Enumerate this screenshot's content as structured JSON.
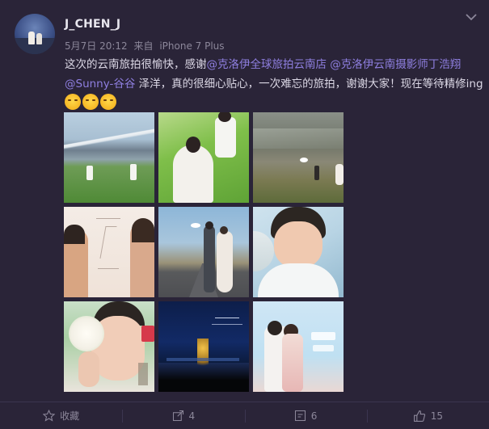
{
  "post": {
    "username": "J_CHEN_J",
    "date": "5月7日 20:12",
    "source_prefix": "来自",
    "source": "iPhone 7 Plus",
    "text_part1": "这次的云南旅拍很愉快，感谢",
    "mention1": "@克洛伊全球旅拍云南店",
    "mention2": "@克洛伊云南摄影师丁浩翔",
    "mention3": "@Sunny-谷谷",
    "text_part2": " 泽洋，真的很细心贴心，一次难忘的旅拍，谢谢大家！现在等待精修ing",
    "emoji_name": "hug-emoji",
    "emoji_count": 3
  },
  "photos": [
    {
      "name": "photo-mountain-field"
    },
    {
      "name": "photo-grass-couple"
    },
    {
      "name": "photo-plateau-couple"
    },
    {
      "name": "photo-portrait-poster"
    },
    {
      "name": "photo-road-couple"
    },
    {
      "name": "photo-bride-closeup"
    },
    {
      "name": "photo-flowers-face"
    },
    {
      "name": "photo-night-lake"
    },
    {
      "name": "photo-kiss-poster"
    }
  ],
  "footer": {
    "favorite_label": "收藏",
    "favorite_icon": "star-icon",
    "share_count": "4",
    "share_icon": "share-icon",
    "comment_count": "6",
    "comment_icon": "comment-icon",
    "like_count": "15",
    "like_icon": "thumbs-up-icon"
  },
  "colors": {
    "background": "#2a2438",
    "mention": "#8f7fe0",
    "muted": "#8c879a"
  }
}
